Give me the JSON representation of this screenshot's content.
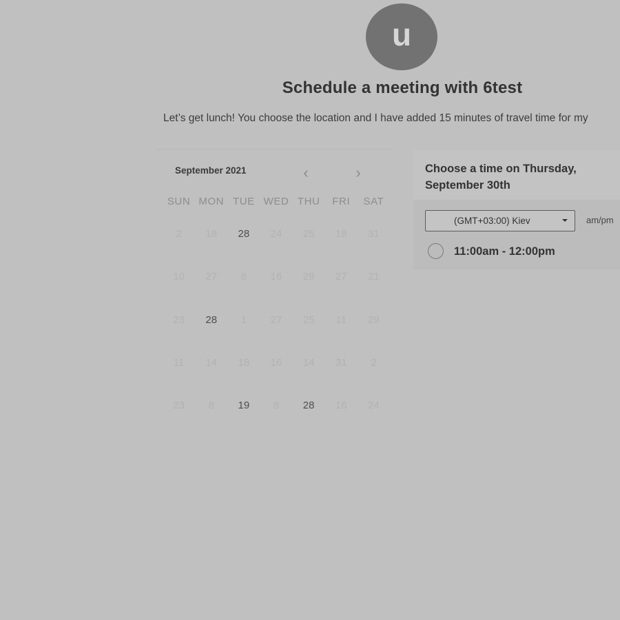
{
  "avatar": {
    "initial": "u"
  },
  "header": {
    "title": "Schedule a meeting with 6test",
    "description": "Let’s get lunch! You choose the location and I have added 15 minutes of travel time for my"
  },
  "calendar": {
    "month_label": "September 2021",
    "prev_icon": "chevron-left-icon",
    "next_icon": "chevron-right-icon",
    "prev_glyph": "‹",
    "next_glyph": "›",
    "weekdays": [
      "SUN",
      "MON",
      "TUE",
      "WED",
      "THU",
      "FRI",
      "SAT"
    ],
    "weeks": [
      [
        {
          "d": "2",
          "a": false
        },
        {
          "d": "18",
          "a": false
        },
        {
          "d": "28",
          "a": true
        },
        {
          "d": "24",
          "a": false
        },
        {
          "d": "25",
          "a": false
        },
        {
          "d": "18",
          "a": false
        },
        {
          "d": "31",
          "a": false
        }
      ],
      [
        {
          "d": "10",
          "a": false
        },
        {
          "d": "27",
          "a": false
        },
        {
          "d": "8",
          "a": false
        },
        {
          "d": "16",
          "a": false
        },
        {
          "d": "29",
          "a": false
        },
        {
          "d": "27",
          "a": false
        },
        {
          "d": "21",
          "a": false
        }
      ],
      [
        {
          "d": "23",
          "a": false
        },
        {
          "d": "28",
          "a": true
        },
        {
          "d": "1",
          "a": false
        },
        {
          "d": "27",
          "a": false
        },
        {
          "d": "25",
          "a": false
        },
        {
          "d": "11",
          "a": false
        },
        {
          "d": "29",
          "a": false
        }
      ],
      [
        {
          "d": "11",
          "a": false
        },
        {
          "d": "14",
          "a": false
        },
        {
          "d": "18",
          "a": false
        },
        {
          "d": "16",
          "a": false
        },
        {
          "d": "14",
          "a": false
        },
        {
          "d": "31",
          "a": false
        },
        {
          "d": "2",
          "a": false
        }
      ],
      [
        {
          "d": "23",
          "a": false
        },
        {
          "d": "8",
          "a": false
        },
        {
          "d": "19",
          "a": true
        },
        {
          "d": "8",
          "a": false
        },
        {
          "d": "28",
          "a": true
        },
        {
          "d": "16",
          "a": false
        },
        {
          "d": "24",
          "a": false
        }
      ]
    ]
  },
  "times": {
    "heading": "Choose a time on Thursday, September 30th",
    "timezone": {
      "selected": "(GMT+03:00) Kiev",
      "icon": "caret-down-icon"
    },
    "format_toggle": "am/pm",
    "slots": [
      {
        "label": "11:00am - 12:00pm"
      }
    ]
  },
  "colors": {
    "background": "#c0c0c0",
    "avatar": "#727272",
    "text_dark": "#333333",
    "day_active": "#4e4e4e",
    "day_inactive": "#b2b2b2"
  }
}
